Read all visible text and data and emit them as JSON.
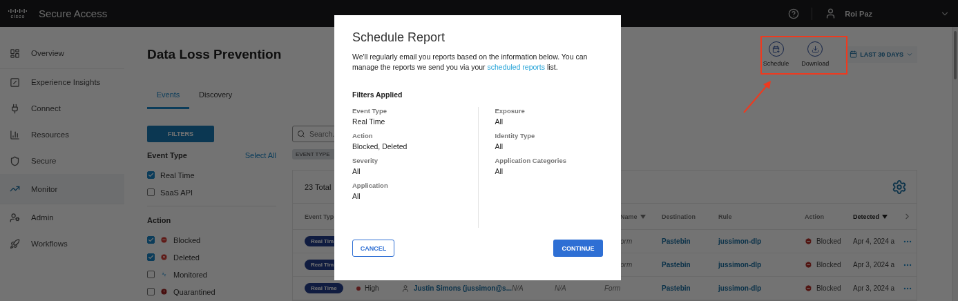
{
  "topbar": {
    "logo_text": "cisco",
    "product": "Secure Access",
    "user": "Roi Paz"
  },
  "sidebar": {
    "items": [
      {
        "label": "Overview",
        "selected": false
      },
      {
        "label": "Experience Insights",
        "selected": false
      },
      {
        "label": "Connect",
        "selected": false
      },
      {
        "label": "Resources",
        "selected": false
      },
      {
        "label": "Secure",
        "selected": false
      },
      {
        "label": "Monitor",
        "selected": true
      },
      {
        "label": "Admin",
        "selected": false
      },
      {
        "label": "Workflows",
        "selected": false
      }
    ]
  },
  "page": {
    "title": "Data Loss Prevention",
    "actions": [
      {
        "label": "Schedule",
        "kind": "schedule"
      },
      {
        "label": "Download",
        "kind": "download"
      }
    ],
    "date_range": "LAST 30 DAYS",
    "tabs": [
      {
        "label": "Events",
        "selected": true
      },
      {
        "label": "Discovery",
        "selected": false
      }
    ]
  },
  "filters": {
    "button": "FILTERS",
    "groups": [
      {
        "title": "Event Type",
        "link": "Select All",
        "options": [
          {
            "label": "Real Time",
            "checked": true
          },
          {
            "label": "SaaS API",
            "checked": false
          }
        ]
      },
      {
        "title": "Action",
        "options": [
          {
            "label": "Blocked",
            "checked": true,
            "kind": "blocked"
          },
          {
            "label": "Deleted",
            "checked": true,
            "kind": "deleted"
          },
          {
            "label": "Monitored",
            "checked": false,
            "kind": "monitored"
          },
          {
            "label": "Quarantined",
            "checked": false,
            "kind": "quarantined"
          }
        ]
      }
    ]
  },
  "search": {
    "placeholder": "Search."
  },
  "chip": "EVENT TYPE",
  "table": {
    "total": "23 Total",
    "columns": [
      {
        "label": "Event Typ"
      },
      {
        "label": "Name",
        "sorted": false
      },
      {
        "label": "Destination"
      },
      {
        "label": "Rule"
      },
      {
        "label": "Action"
      },
      {
        "label": "Detected",
        "sorted": true
      }
    ],
    "rows": [
      {
        "event_type": "Real Tim",
        "name": "orm",
        "destination": "Pastebin",
        "rule": "jussimon-dlp",
        "action": "Blocked",
        "detected": "Apr 4, 2024 a"
      },
      {
        "event_type": "Real Tim",
        "name": "orm",
        "destination": "Pastebin",
        "rule": "jussimon-dlp",
        "action": "Blocked",
        "detected": "Apr 3, 2024 a"
      },
      {
        "event_type": "Real Time",
        "severity": "High",
        "user": "Justin Simons (jussimon@s...",
        "exposure": "N/A",
        "column_5": "N/A",
        "name": "Form",
        "destination": "Pastebin",
        "rule": "jussimon-dlp",
        "action": "Blocked",
        "detected": "Apr 3, 2024 a"
      }
    ]
  },
  "modal": {
    "title": "Schedule Report",
    "text_before": "We'll regularly email you reports based on the information below. You can manage the reports we send you via your ",
    "link": "scheduled reports",
    "text_after": " list.",
    "section": "Filters Applied",
    "left": [
      {
        "label": "Event Type",
        "value": "Real Time"
      },
      {
        "label": "Action",
        "value": "Blocked, Deleted"
      },
      {
        "label": "Severity",
        "value": "All"
      },
      {
        "label": "Application",
        "value": "All"
      }
    ],
    "right": [
      {
        "label": "Exposure",
        "value": "All"
      },
      {
        "label": "Identity Type",
        "value": "All"
      },
      {
        "label": "Application Categories",
        "value": "All"
      }
    ],
    "cancel": "CANCEL",
    "continue": "CONTINUE"
  }
}
